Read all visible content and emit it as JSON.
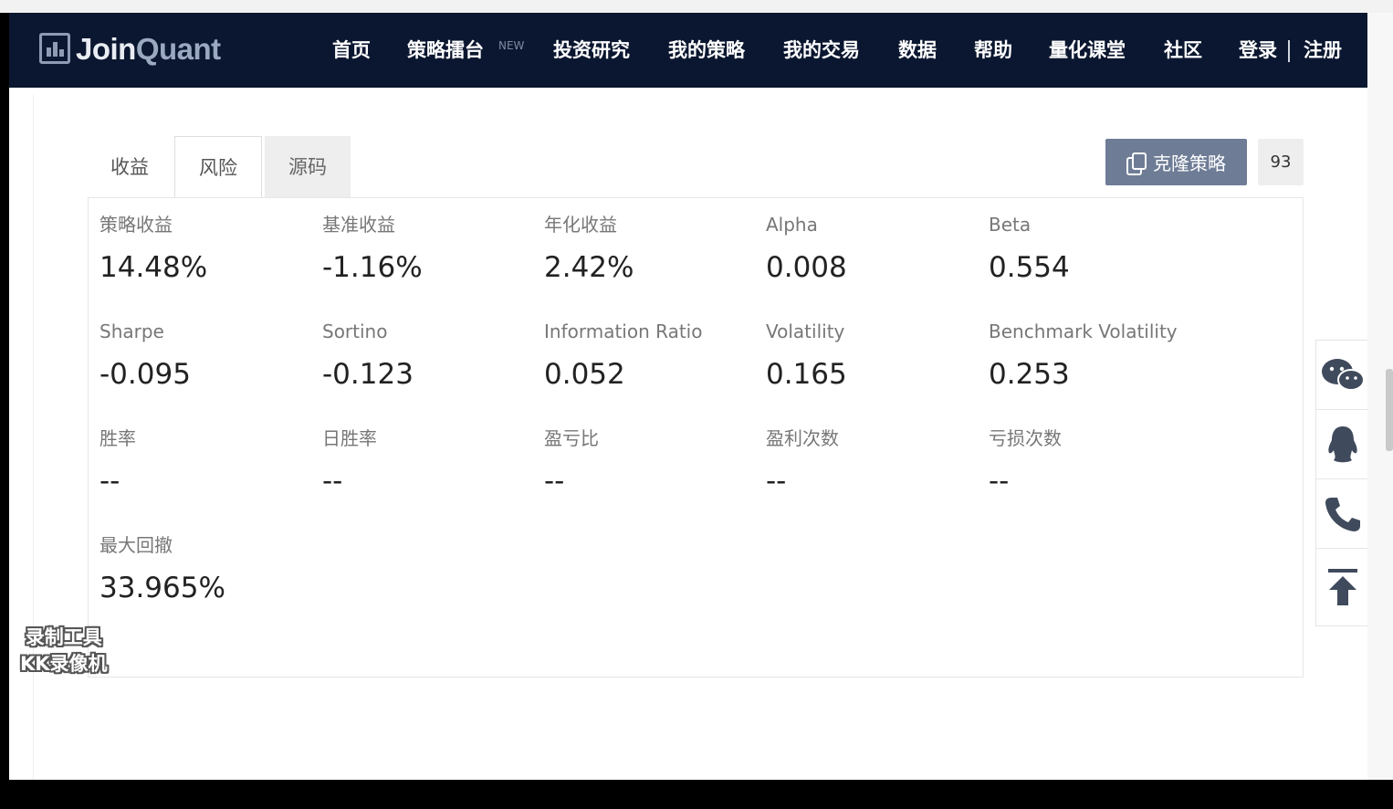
{
  "navbar": {
    "logo_join": "Join",
    "logo_quant": "Quant",
    "links": [
      "首页",
      "策略擂台",
      "投资研究",
      "我的策略",
      "我的交易",
      "数据",
      "帮助",
      "量化课堂",
      "社区",
      "登录",
      "注册"
    ],
    "new_badge": "NEW"
  },
  "tabs": [
    "收益",
    "风险",
    "源码"
  ],
  "active_tab": "风险",
  "clone_button": "克隆策略",
  "clone_count": "93",
  "metrics": [
    {
      "label": "策略收益",
      "value": "14.48%"
    },
    {
      "label": "基准收益",
      "value": "-1.16%"
    },
    {
      "label": "年化收益",
      "value": "2.42%"
    },
    {
      "label": "Alpha",
      "value": "0.008"
    },
    {
      "label": "Beta",
      "value": "0.554"
    },
    {
      "label": "Sharpe",
      "value": "-0.095"
    },
    {
      "label": "Sortino",
      "value": "-0.123"
    },
    {
      "label": "Information Ratio",
      "value": "0.052"
    },
    {
      "label": "Volatility",
      "value": "0.165"
    },
    {
      "label": "Benchmark Volatility",
      "value": "0.253"
    },
    {
      "label": "胜率",
      "value": "--"
    },
    {
      "label": "日胜率",
      "value": "--"
    },
    {
      "label": "盈亏比",
      "value": "--"
    },
    {
      "label": "盈利次数",
      "value": "--"
    },
    {
      "label": "亏损次数",
      "value": "--"
    },
    {
      "label": "最大回撤",
      "value": "33.965%"
    }
  ],
  "side_widget": [
    "wechat-icon",
    "qq-icon",
    "phone-icon",
    "back-to-top-icon"
  ],
  "watermark": {
    "line1": "录制工具",
    "line2": "KK录像机"
  },
  "colors": {
    "navbar_bg": "#0b1730",
    "clone_btn": "#6e7c96"
  }
}
